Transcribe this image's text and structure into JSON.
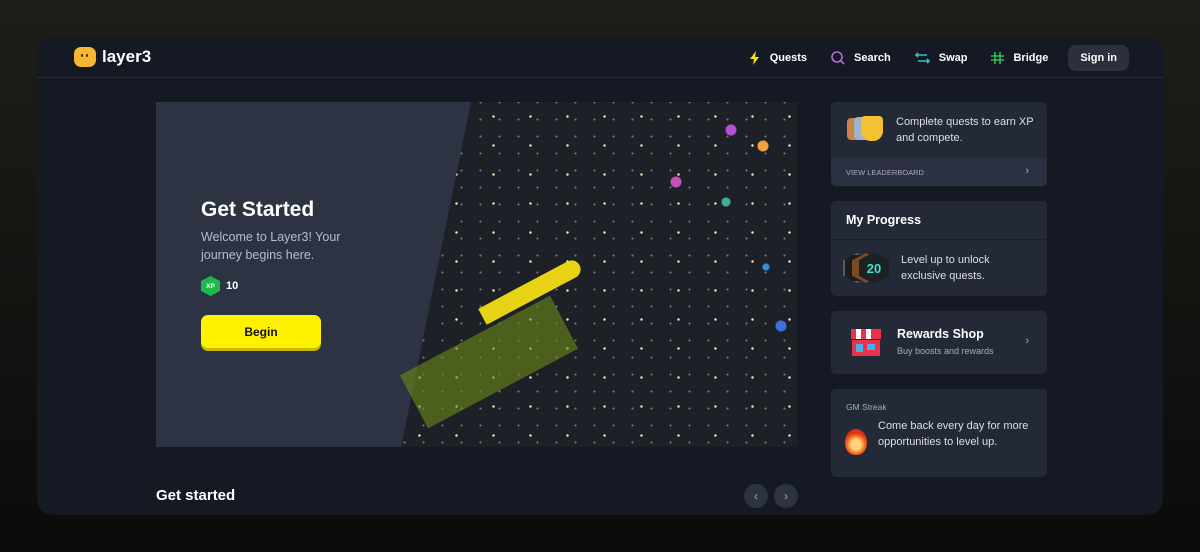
{
  "header": {
    "logo": "layer3",
    "nav": [
      {
        "label": "Quests",
        "icon": "lightning-icon",
        "color": "#f5e61a"
      },
      {
        "label": "Search",
        "icon": "search-icon",
        "color": "#b86ad8"
      },
      {
        "label": "Swap",
        "icon": "swap-icon",
        "color": "#39c0c8"
      },
      {
        "label": "Bridge",
        "icon": "bridge-icon",
        "color": "#2fbf4f"
      }
    ],
    "sign_in": "Sign in"
  },
  "hero": {
    "title": "Get Started",
    "subtitle": "Welcome to Layer3! Your journey begins here.",
    "xp_badge": "XP",
    "xp": "10",
    "button": "Begin"
  },
  "section": {
    "title": "Get started"
  },
  "leaderboard": {
    "text": "Complete quests to earn XP and compete.",
    "link": "VIEW LEADERBOARD"
  },
  "progress": {
    "title": "My Progress",
    "level": "20",
    "text": "Level up to unlock exclusive quests."
  },
  "shop": {
    "title": "Rewards Shop",
    "subtitle": "Buy boosts and rewards"
  },
  "streak": {
    "label": "GM Streak",
    "text": "Come back every day for more opportunities to level up."
  },
  "colors": {
    "accent": "#fff200",
    "bg": "#151923",
    "card": "#232937"
  }
}
